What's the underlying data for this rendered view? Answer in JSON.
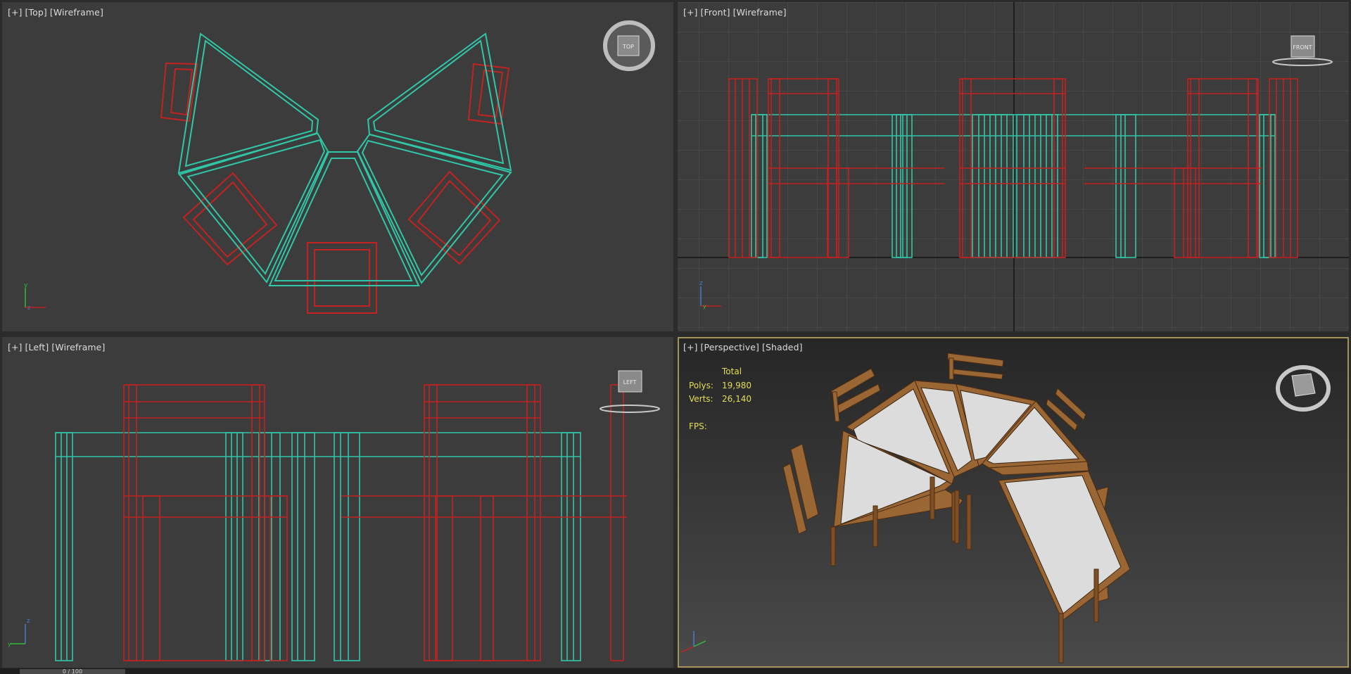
{
  "viewports": {
    "top": {
      "labels": [
        "[+]",
        "[Top]",
        "[Wireframe]"
      ],
      "cube": "TOP"
    },
    "front": {
      "labels": [
        "[+]",
        "[Front]",
        "[Wireframe]"
      ],
      "cube": "FRONT"
    },
    "left": {
      "labels": [
        "[+]",
        "[Left]",
        "[Wireframe]"
      ],
      "cube": "LEFT"
    },
    "perspective": {
      "labels": [
        "[+]",
        "[Perspective]",
        "[Shaded]"
      ],
      "stats": {
        "total_label": "Total",
        "polys_label": "Polys:",
        "polys": "19,980",
        "verts_label": "Verts:",
        "verts": "26,140",
        "fps_label": "FPS:"
      }
    }
  },
  "axes": {
    "x": "x",
    "y": "y",
    "z": "z"
  },
  "time_slider": "0 / 100",
  "colors": {
    "table_wire": "#2fc7a8",
    "chair_wire": "#c42121",
    "active_border": "#a4925a",
    "stats_text": "#e6dc58",
    "wood": "#9a6634",
    "table_top": "#dcdcdc"
  }
}
